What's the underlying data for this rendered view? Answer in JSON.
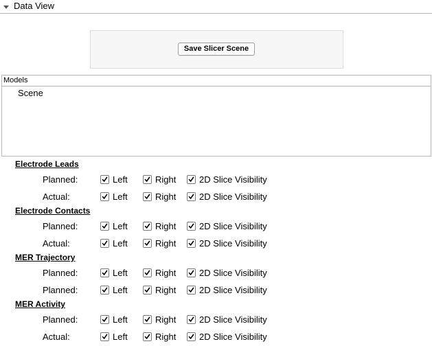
{
  "section": {
    "title": "Data View"
  },
  "save_button": {
    "label": "Save Slicer Scene"
  },
  "models": {
    "header": "Models",
    "items": [
      "Scene"
    ]
  },
  "option_labels": {
    "left": "Left",
    "right": "Right",
    "slice": "2D Slice Visibility"
  },
  "groups": [
    {
      "title": "Electrode Leads",
      "rows": [
        {
          "label": "Planned:",
          "left": true,
          "right": true,
          "slice": true
        },
        {
          "label": "Actual:",
          "left": true,
          "right": true,
          "slice": true
        }
      ]
    },
    {
      "title": "Electrode Contacts",
      "rows": [
        {
          "label": "Planned:",
          "left": true,
          "right": true,
          "slice": true
        },
        {
          "label": "Actual:",
          "left": true,
          "right": true,
          "slice": true
        }
      ]
    },
    {
      "title": "MER Trajectory",
      "rows": [
        {
          "label": "Planned:",
          "left": true,
          "right": true,
          "slice": true
        },
        {
          "label": "Planned:",
          "left": true,
          "right": true,
          "slice": true
        }
      ]
    },
    {
      "title": "MER Activity",
      "rows": [
        {
          "label": "Planned:",
          "left": true,
          "right": true,
          "slice": true
        },
        {
          "label": "Actual:",
          "left": true,
          "right": true,
          "slice": true
        }
      ]
    }
  ]
}
